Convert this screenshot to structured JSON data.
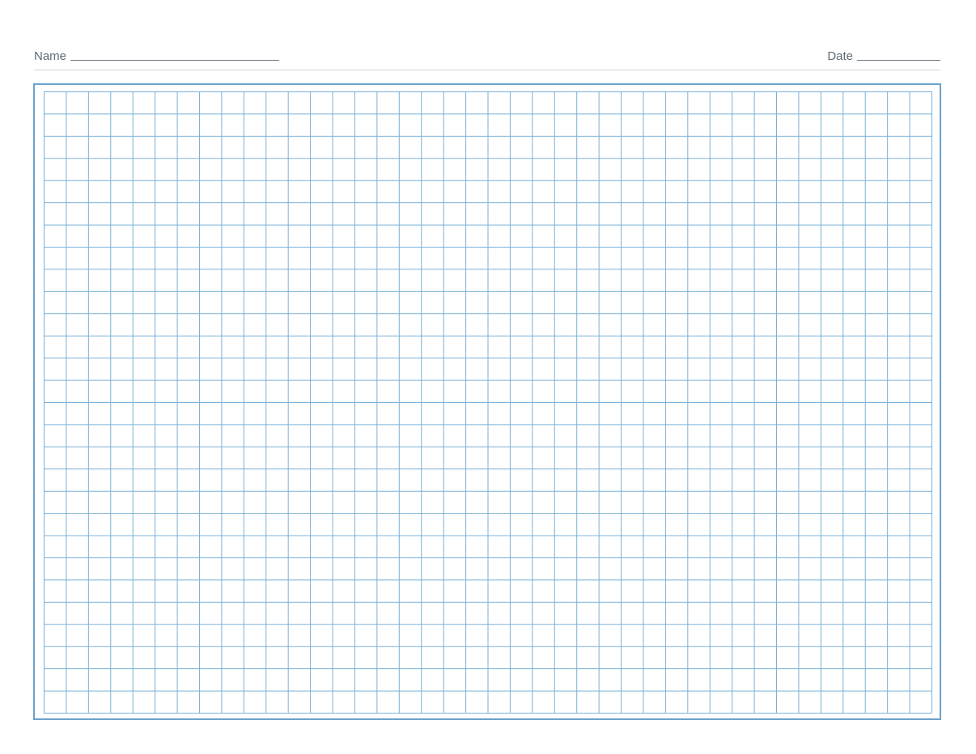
{
  "header": {
    "name_label": "Name",
    "date_label": "Date"
  },
  "grid": {
    "columns": 40,
    "rows": 28,
    "line_color": "#7ab1d8",
    "frame_color": "#6aa2cc"
  }
}
